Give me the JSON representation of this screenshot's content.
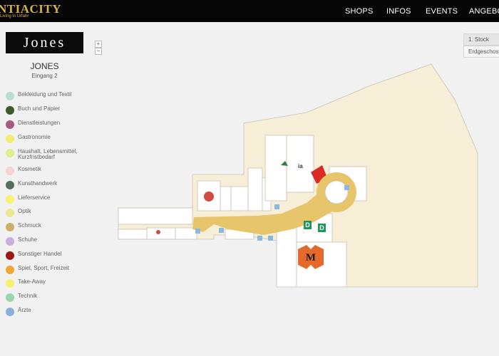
{
  "header": {
    "logo_text": "NTIACITY",
    "logo_tagline": "Living in Urfahr",
    "nav": [
      "SHOPS",
      "INFOS",
      "EVENTS",
      "ANGEBOTE"
    ]
  },
  "shop": {
    "logo_text": "Jones",
    "name": "JONES",
    "entrance": "Eingang 2"
  },
  "zoom": {
    "in": "+",
    "out": "−"
  },
  "floors": [
    "1. Stock",
    "Erdgeschoss"
  ],
  "legend": [
    {
      "label": "Bekleidung und Textil",
      "color": "#b9ded0"
    },
    {
      "label": "Buch und Papier",
      "color": "#3c5a2b"
    },
    {
      "label": "Dienstleistungen",
      "color": "#a65a7e"
    },
    {
      "label": "Gastronomie",
      "color": "#f3ee72"
    },
    {
      "label": "Haushalt, Lebensmittel, Kurzfristbedarf",
      "color": "#dcef8a"
    },
    {
      "label": "Kosmetik",
      "color": "#f7d2d2"
    },
    {
      "label": "Kunsthandwerk",
      "color": "#53705b"
    },
    {
      "label": "Lieferservice",
      "color": "#f8f171"
    },
    {
      "label": "Optik",
      "color": "#ece890"
    },
    {
      "label": "Schmuck",
      "color": "#ccb067"
    },
    {
      "label": "Schuhe",
      "color": "#c6aede"
    },
    {
      "label": "Sonstiger Handel",
      "color": "#9c1616"
    },
    {
      "label": "Spiel, Sport, Freizeit",
      "color": "#f2a636"
    },
    {
      "label": "Take-Away",
      "color": "#f5f16c"
    },
    {
      "label": "Technik",
      "color": "#9bd4ab"
    },
    {
      "label": "Ärzte",
      "color": "#8bb0dc"
    }
  ],
  "map": {
    "colors": {
      "background_area": "#f6eed7",
      "shop": "#ffffff",
      "walkway": "#e7c56b",
      "highlight_shop": "#d82c24",
      "outline": "#c9c2b2",
      "info_icon": "#8ab8e0",
      "dm_green": "#22955c",
      "mpreis_orange": "#e36a2a"
    },
    "labels": {
      "shop_partial": "ia",
      "store_d1": "D",
      "store_d2": "D",
      "store_m": "M"
    }
  }
}
